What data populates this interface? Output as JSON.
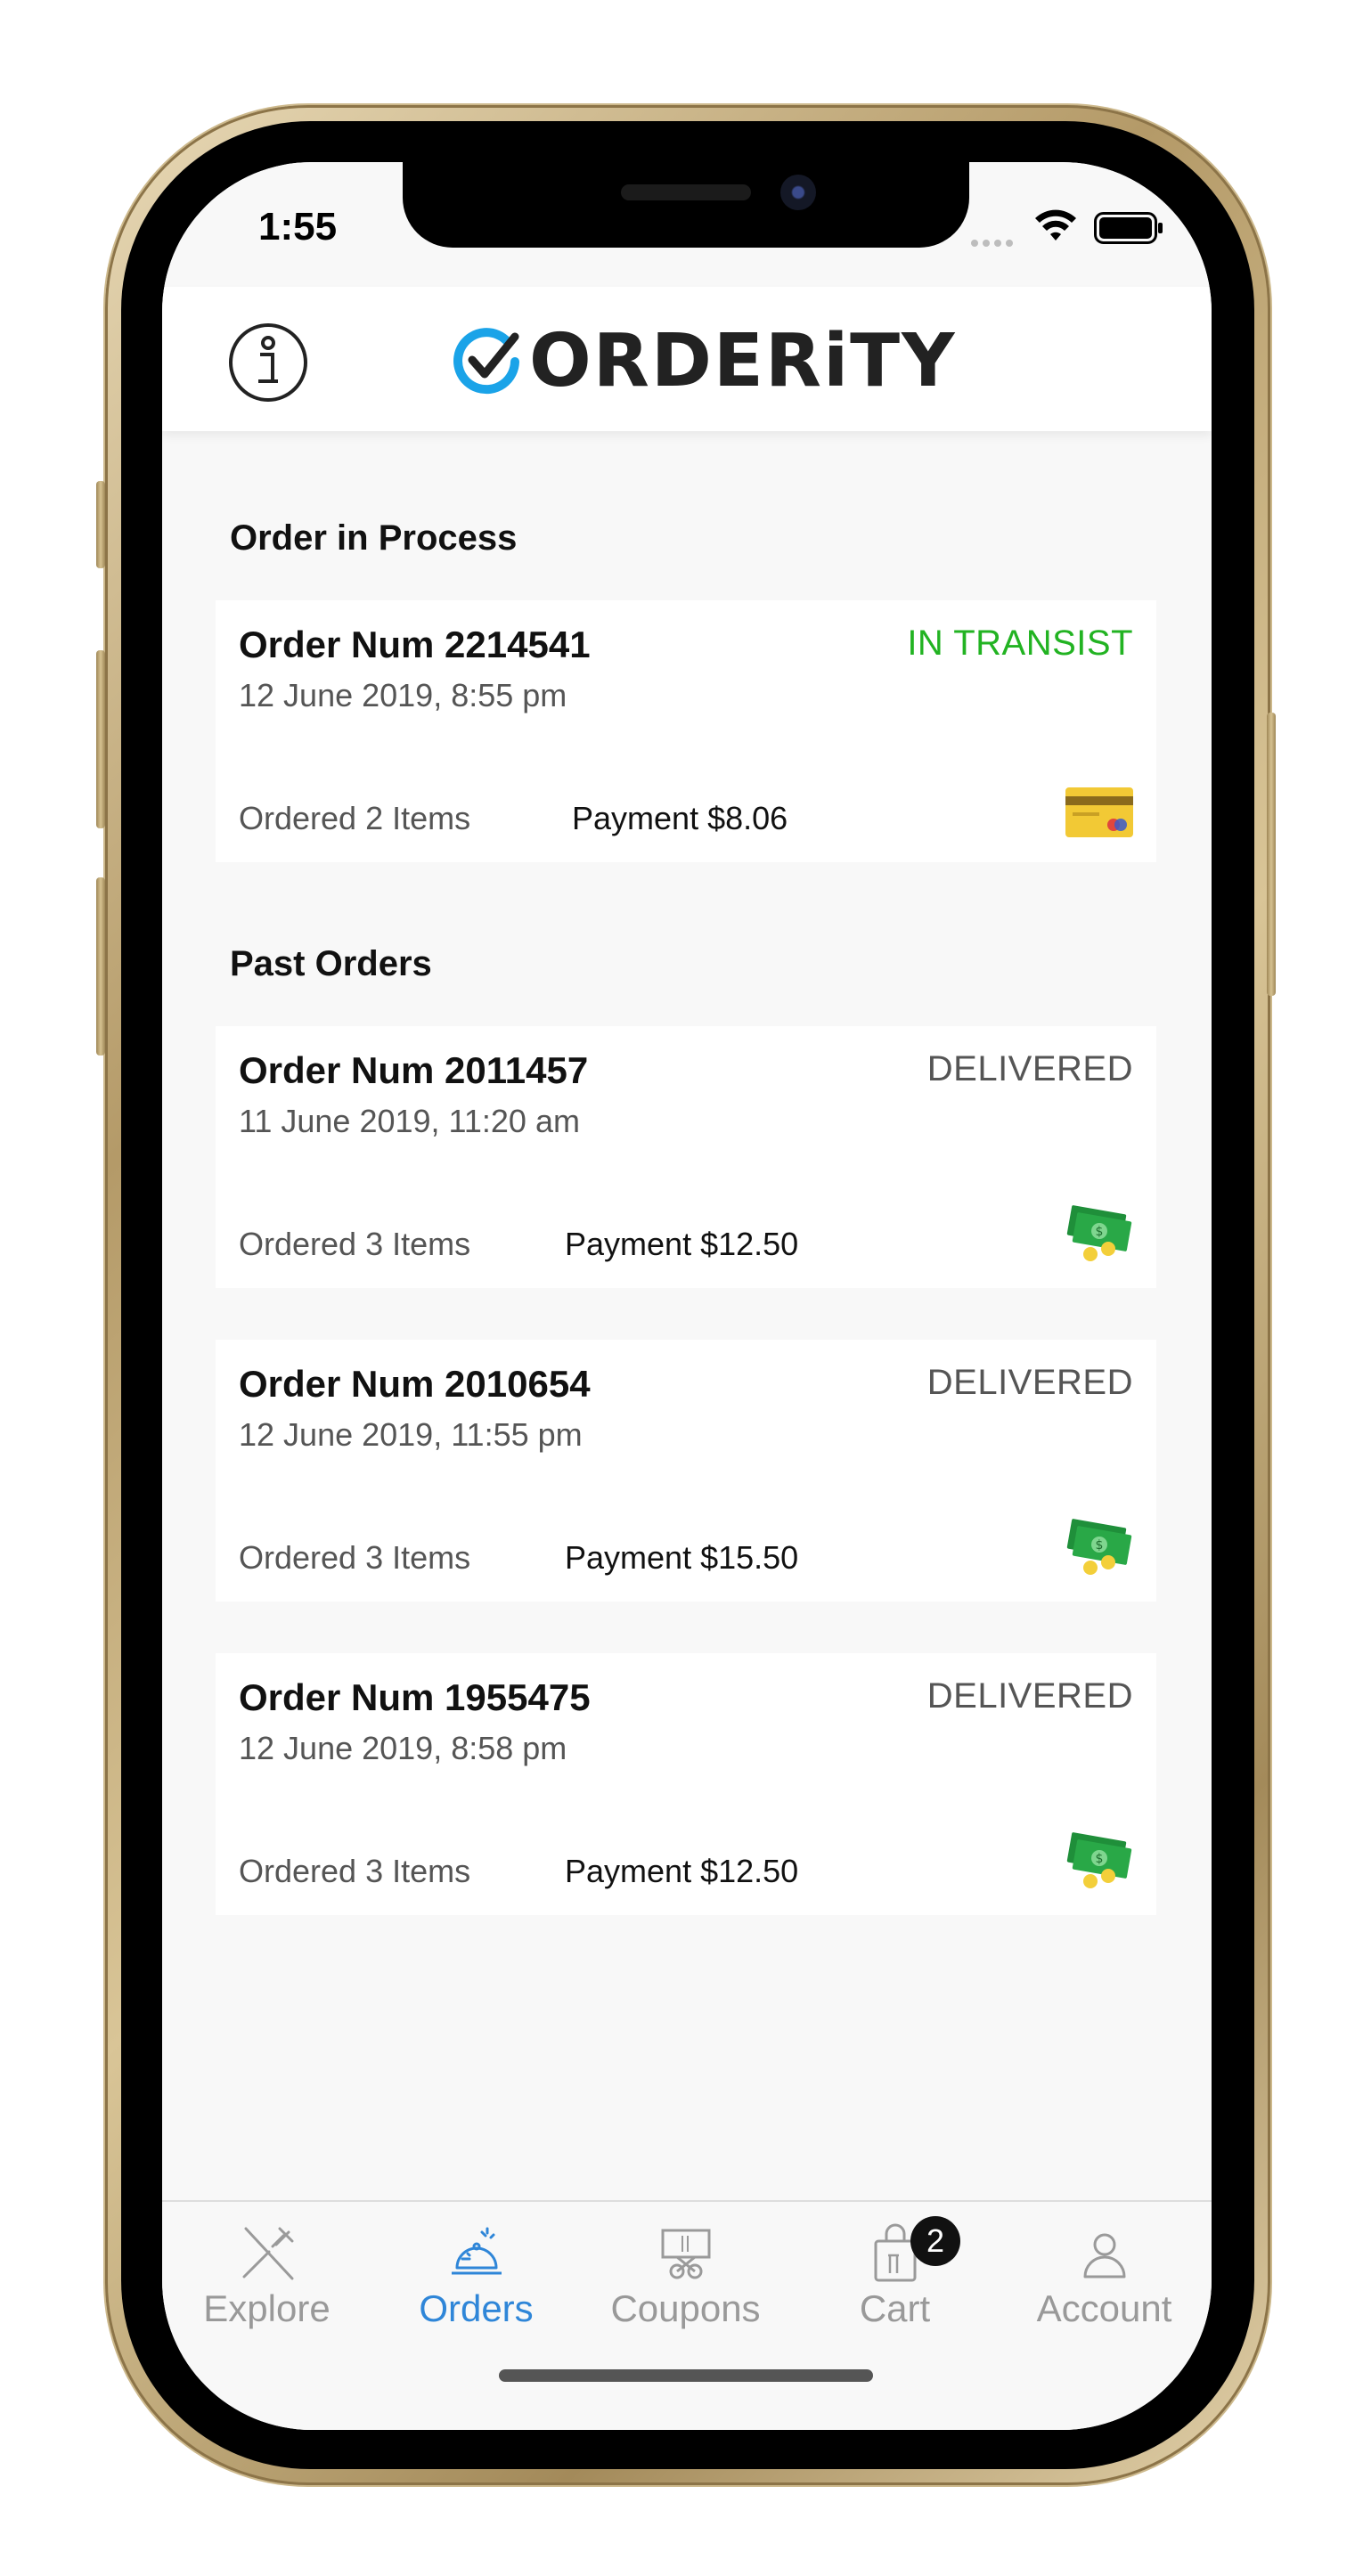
{
  "status_bar": {
    "time": "1:55"
  },
  "header": {
    "brand": "ORDERiTY",
    "icons": {
      "info": "info-icon",
      "logo": "check-circle-icon"
    }
  },
  "sections": {
    "in_process_title": "Order in Process",
    "past_title": "Past Orders"
  },
  "in_process": [
    {
      "number": "Order Num 2214541",
      "status": "IN TRANSIST",
      "date": "12 June 2019, 8:55 pm",
      "items": "Ordered 2 Items",
      "payment": "Payment $8.06",
      "payment_icon": "credit-card-icon"
    }
  ],
  "past_orders": [
    {
      "number": "Order Num 2011457",
      "status": "DELIVERED",
      "date": "11 June 2019, 11:20 am",
      "items": "Ordered 3 Items",
      "payment": "Payment $12.50",
      "payment_icon": "cash-icon"
    },
    {
      "number": "Order Num 2010654",
      "status": "DELIVERED",
      "date": "12 June 2019, 11:55 pm",
      "items": "Ordered 3 Items",
      "payment": "Payment $15.50",
      "payment_icon": "cash-icon"
    },
    {
      "number": "Order Num 1955475",
      "status": "DELIVERED",
      "date": "12 June 2019, 8:58 pm",
      "items": "Ordered 3 Items",
      "payment": "Payment $12.50",
      "payment_icon": "cash-icon"
    }
  ],
  "tab_bar": {
    "tabs": [
      {
        "label": "Explore",
        "icon": "fork-knife-icon",
        "active": false
      },
      {
        "label": "Orders",
        "icon": "cloche-icon",
        "active": true
      },
      {
        "label": "Coupons",
        "icon": "coupon-icon",
        "active": false
      },
      {
        "label": "Cart",
        "icon": "shopping-bag-icon",
        "active": false
      },
      {
        "label": "Account",
        "icon": "user-icon",
        "active": false
      }
    ],
    "cart_badge": "2"
  },
  "colors": {
    "accent": "#2f86d8",
    "transit": "#22b322",
    "logo_blue": "#1aa3e8",
    "background": "#f8f8f8"
  }
}
